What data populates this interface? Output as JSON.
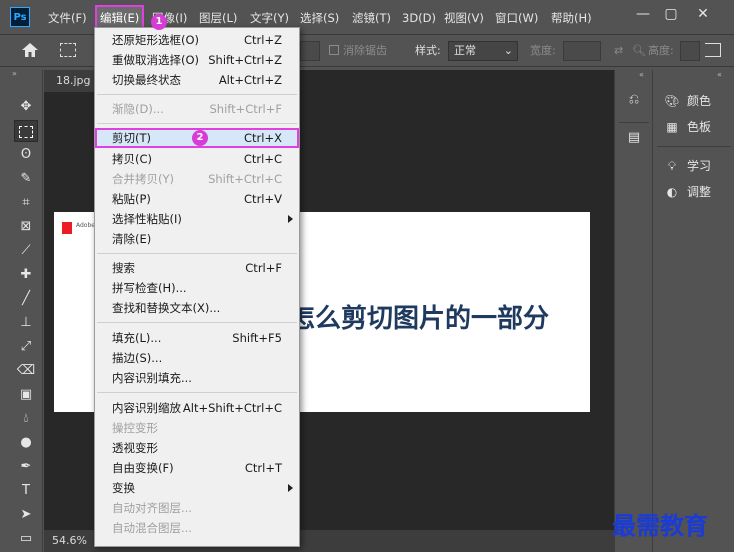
{
  "app": {
    "logo_text": "Ps"
  },
  "menubar": {
    "items": [
      "文件(F)",
      "编辑(E)",
      "图像(I)",
      "图层(L)",
      "文字(Y)",
      "选择(S)",
      "滤镜(T)",
      "3D(D)",
      "视图(V)",
      "窗口(W)",
      "帮助(H)"
    ],
    "active_index": 1
  },
  "window_controls": {
    "minimize": "—",
    "restore": "▢",
    "close": "✕"
  },
  "options_bar": {
    "antialias_label": "消除锯齿",
    "style_label": "样式:",
    "style_value": "正常",
    "width_label": "宽度:",
    "height_label": "高度:"
  },
  "document": {
    "tab_title": "18.jpg @",
    "zoom": "54.6%",
    "canvas_logo_text": "Adobe",
    "canvas_title": "怎么剪切图片的一部分"
  },
  "right_panel": {
    "items": [
      {
        "icon": "palette-icon",
        "label": "颜色"
      },
      {
        "icon": "swatches-icon",
        "label": "色板"
      },
      {
        "icon": "bulb-icon",
        "label": "学习"
      },
      {
        "icon": "adjust-icon",
        "label": "调整"
      }
    ]
  },
  "edit_menu": {
    "items": [
      {
        "label": "还原矩形选框(O)",
        "shortcut": "Ctrl+Z",
        "disabled": false
      },
      {
        "label": "重做取消选择(O)",
        "shortcut": "Shift+Ctrl+Z",
        "disabled": false
      },
      {
        "label": "切换最终状态",
        "shortcut": "Alt+Ctrl+Z",
        "disabled": false
      },
      {
        "label": "渐隐(D)...",
        "shortcut": "Shift+Ctrl+F",
        "disabled": true
      },
      {
        "label": "剪切(T)",
        "shortcut": "Ctrl+X",
        "disabled": false,
        "highlighted": true
      },
      {
        "label": "拷贝(C)",
        "shortcut": "Ctrl+C",
        "disabled": false
      },
      {
        "label": "合并拷贝(Y)",
        "shortcut": "Shift+Ctrl+C",
        "disabled": true
      },
      {
        "label": "粘贴(P)",
        "shortcut": "Ctrl+V",
        "disabled": false
      },
      {
        "label": "选择性粘贴(I)",
        "shortcut": "",
        "disabled": false,
        "submenu": true
      },
      {
        "label": "清除(E)",
        "shortcut": "",
        "disabled": false
      },
      {
        "label": "搜索",
        "shortcut": "Ctrl+F",
        "disabled": false
      },
      {
        "label": "拼写检查(H)...",
        "shortcut": "",
        "disabled": false
      },
      {
        "label": "查找和替换文本(X)...",
        "shortcut": "",
        "disabled": false
      },
      {
        "label": "填充(L)...",
        "shortcut": "Shift+F5",
        "disabled": false
      },
      {
        "label": "描边(S)...",
        "shortcut": "",
        "disabled": false
      },
      {
        "label": "内容识别填充...",
        "shortcut": "",
        "disabled": false
      },
      {
        "label": "内容识别缩放",
        "shortcut": "Alt+Shift+Ctrl+C",
        "disabled": false
      },
      {
        "label": "操控变形",
        "shortcut": "",
        "disabled": true
      },
      {
        "label": "透视变形",
        "shortcut": "",
        "disabled": false
      },
      {
        "label": "自由变换(F)",
        "shortcut": "Ctrl+T",
        "disabled": false
      },
      {
        "label": "变换",
        "shortcut": "",
        "disabled": false,
        "submenu": true
      },
      {
        "label": "自动对齐图层...",
        "shortcut": "",
        "disabled": true
      },
      {
        "label": "自动混合图层...",
        "shortcut": "",
        "disabled": true
      }
    ]
  },
  "annotations": {
    "step1": "1",
    "step2": "2"
  },
  "watermark": "最需教育",
  "colors": {
    "highlight_border": "#e040e0",
    "badge": "#d63cd6",
    "menu_bg": "#f0f0f0",
    "ui_bg": "#535353"
  }
}
